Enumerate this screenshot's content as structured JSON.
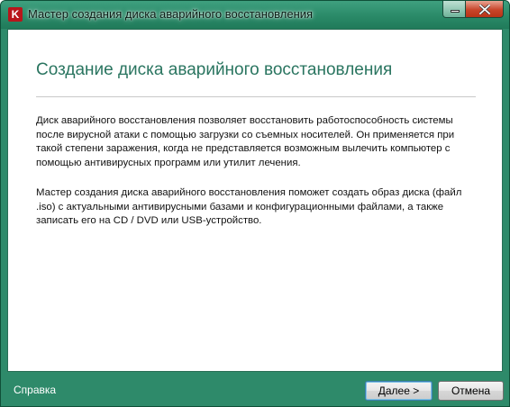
{
  "window": {
    "title": "Мастер создания диска аварийного восстановления",
    "icon_letter": "K",
    "accent_color": "#2e8a6a"
  },
  "main": {
    "heading": "Создание диска аварийного восстановления",
    "paragraph1": "Диск аварийного восстановления позволяет восстановить работоспособность системы после вирусной атаки с помощью загрузки со съемных носителей. Он применяется при такой степени заражения, когда не представляется возможным вылечить компьютер с помощью антивирусных программ или утилит лечения.",
    "paragraph2": "Мастер создания диска аварийного восстановления поможет создать образ диска (файл .iso) с актуальными антивирусными базами и конфигурационными файлами, а также записать его на CD / DVD или USB-устройство."
  },
  "footer": {
    "help": "Справка",
    "next": "Далее >",
    "cancel": "Отмена"
  }
}
